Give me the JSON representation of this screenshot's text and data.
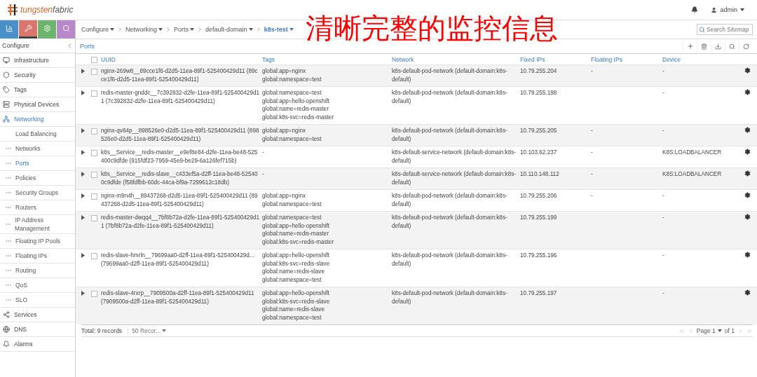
{
  "header": {
    "logo_first": "tungsten",
    "logo_second": "fabric",
    "user": "admin"
  },
  "annotation": "清晰完整的监控信息",
  "sidebar": {
    "tabs": [
      {
        "selected": false
      },
      {
        "selected": true
      },
      {
        "selected": false
      },
      {
        "selected": false
      }
    ],
    "title": "Configure",
    "items": [
      {
        "label": "Infrastructure",
        "selected": false
      },
      {
        "label": "Security",
        "selected": false
      },
      {
        "label": "Tags",
        "selected": false
      },
      {
        "label": "Physical Devices",
        "selected": false
      },
      {
        "label": "Networking",
        "selected": true,
        "children": [
          {
            "label": "Load Balancing",
            "kind": "group",
            "selected": false
          },
          {
            "label": "Networks",
            "kind": "link",
            "selected": false
          },
          {
            "label": "Ports",
            "kind": "link",
            "selected": true
          },
          {
            "label": "Policies",
            "kind": "link",
            "selected": false
          },
          {
            "label": "Security Groups",
            "kind": "link",
            "selected": false
          },
          {
            "label": "Routers",
            "kind": "link",
            "selected": false
          },
          {
            "label": "IP Address Management",
            "kind": "link",
            "selected": false
          },
          {
            "label": "Floating IP Pools",
            "kind": "link",
            "selected": false
          },
          {
            "label": "Floating IPs",
            "kind": "link",
            "selected": false
          },
          {
            "label": "Routing",
            "kind": "link",
            "selected": false
          },
          {
            "label": "QoS",
            "kind": "link",
            "selected": false
          },
          {
            "label": "SLO",
            "kind": "link",
            "selected": false
          }
        ]
      },
      {
        "label": "Services",
        "selected": false
      },
      {
        "label": "DNS",
        "selected": false
      },
      {
        "label": "Alarms",
        "selected": false
      }
    ]
  },
  "breadcrumb": [
    {
      "label": "Configure",
      "selected": false
    },
    {
      "label": "Networking",
      "selected": false
    },
    {
      "label": "Ports",
      "selected": false
    },
    {
      "label": "default-domain",
      "selected": false
    },
    {
      "label": "k8s-test",
      "selected": true
    }
  ],
  "search": {
    "placeholder": "Search Sitemap"
  },
  "panel": {
    "title": "Ports",
    "select_all_checked": false,
    "columns": [
      "UUID",
      "Tags",
      "Network",
      "Fixed IPs",
      "Floating IPs",
      "Device"
    ],
    "rows": [
      {
        "expanded": false,
        "checked": false,
        "uuid": "nginx-269w8__89cce1f6-d2d5-11ea-89f1-525400429d11 (89cce1f6-d2d5-11ea-89f1-525400429d11)",
        "tags": [
          "global:app=nginx",
          "global:namespace=test"
        ],
        "network": "k8s-default-pod-network (default-domain:k8s-default)",
        "fixed_ips": "10.79.255.204",
        "floating_ips": "-",
        "device": "-"
      },
      {
        "expanded": false,
        "checked": false,
        "uuid": "redis-master-gnddc__7c392832-d2fe-11ea-89f1-525400429d11 (7c392832-d2fe-11ea-89f1-525400429d11)",
        "tags": [
          "global:namespace=test",
          "global:app=hello-openshift",
          "global:name=redis-master",
          "global:k8s-svc=redis-master"
        ],
        "network": "k8s-default-pod-network (default-domain:k8s-default)",
        "fixed_ips": "10.79.255.198",
        "device": "-"
      },
      {
        "expanded": false,
        "checked": false,
        "uuid": "nginx-qv84p__898526e0-d2d5-11ea-89f1-525400429d11 (898526e0-d2d5-11ea-89f1-525400429d11)",
        "tags": [
          "global:app=nginx",
          "global:namespace=test"
        ],
        "network": "k8s-default-pod-network (default-domain:k8s-default)",
        "fixed_ips": "10.79.255.205",
        "floating_ips": "-",
        "device": "-"
      },
      {
        "expanded": false,
        "checked": false,
        "uuid": "k8s__Service__redis-master__e9ef8e84-d2fe-11ea-be48-525400c9dfde (915fdf23-7959-45e9-be29-6a126fef715b)",
        "tags": [
          "-"
        ],
        "network": "k8s-default-service-network (default-domain:k8s-default)",
        "fixed_ips": "10.103.62.237",
        "floating_ips": "-",
        "device": "K8S:LOADBALANCER"
      },
      {
        "expanded": false,
        "checked": false,
        "uuid": "k8s__Service__redis-slave__c433ef5a-d2ff-11ea-be48-525400c9dfde (f58fdfbb-60dc-44ca-bf9a-7299612c18db)",
        "tags": [
          "-"
        ],
        "network": "k8s-default-service-network (default-domain:k8s-default)",
        "fixed_ips": "10.110.148.112",
        "floating_ips": "-",
        "device": "K8S:LOADBALANCER"
      },
      {
        "expanded": false,
        "checked": false,
        "uuid": "nginx-m9n4h__89437268-d2d5-11ea-89f1-525400429d11 (89437268-d2d5-11ea-89f1-525400429d11)",
        "tags": [
          "global:app=nginx",
          "global:namespace=test"
        ],
        "network": "k8s-default-pod-network (default-domain:k8s-default)",
        "fixed_ips": "10.79.255.206",
        "floating_ips": "-",
        "device": "-"
      },
      {
        "expanded": false,
        "checked": false,
        "uuid": "redis-master-dwqq4__7bf8b72a-d2fe-11ea-89f1-525400429d11 (7bf8b72a-d2fe-11ea-89f1-525400429d11)",
        "tags": [
          "global:namespace=test",
          "global:app=hello-openshift",
          "global:name=redis-master",
          "global:k8s-svc=redis-master"
        ],
        "network": "k8s-default-pod-network (default-domain:k8s-default)",
        "fixed_ips": "10.79.255.199",
        "device": "-"
      },
      {
        "expanded": false,
        "checked": false,
        "uuid": "redis-slave-hmrln__79699aa0-d2ff-11ea-89f1-525400429d... (79699aa0-d2ff-11ea-89f1-525400429d11)",
        "tags": [
          "global:app=hello-openshift",
          "global:k8s-svc=redis-slave",
          "global:name=redis-slave",
          "global:namespace=test"
        ],
        "network": "k8s-default-pod-network (default-domain:k8s-default)",
        "fixed_ips": "10.79.255.196",
        "device": "-"
      },
      {
        "expanded": false,
        "checked": false,
        "uuid": "redis-slave-4rxrp__7909500a-d2ff-11ea-89f1-525400429d11 (7909500a-d2ff-11ea-89f1-525400429d11)",
        "tags": [
          "global:app=hello-openshift",
          "global:k8s-svc=redis-slave",
          "global:name=redis-slave",
          "global:namespace=test"
        ],
        "network": "k8s-default-pod-network (default-domain:k8s-default)",
        "fixed_ips": "10.79.255.197",
        "device": "-"
      }
    ],
    "total": "Total: 9 records",
    "page_size": "50 Recor...",
    "page": "Page 1",
    "page_of": "of 1"
  }
}
